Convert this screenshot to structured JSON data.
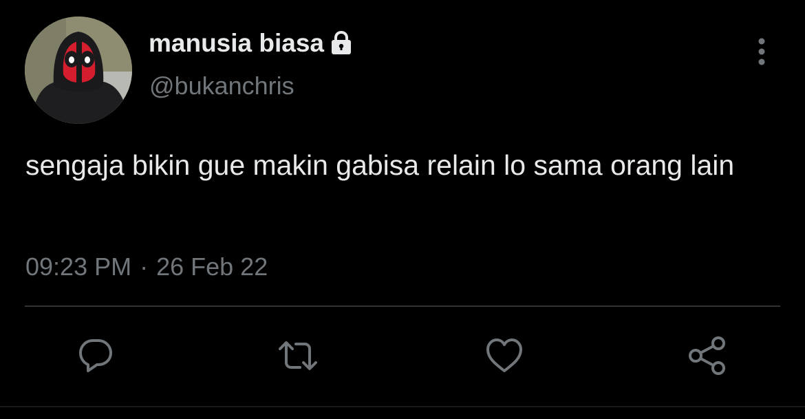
{
  "tweet": {
    "display_name": "manusia biasa",
    "handle": "@bukanchris",
    "text": "sengaja bikin gue makin gabisa relain lo sama orang lain",
    "time": "09:23 PM",
    "separator": "·",
    "date": "26 Feb 22"
  },
  "icons": {
    "protected": "lock-icon",
    "more": "more-vertical-icon",
    "reply": "reply-icon",
    "retweet": "retweet-icon",
    "like": "heart-icon",
    "share": "share-icon"
  },
  "colors": {
    "background": "#000000",
    "primary_text": "#e7e9ea",
    "secondary_text": "#71767b",
    "divider": "#2f3336"
  }
}
